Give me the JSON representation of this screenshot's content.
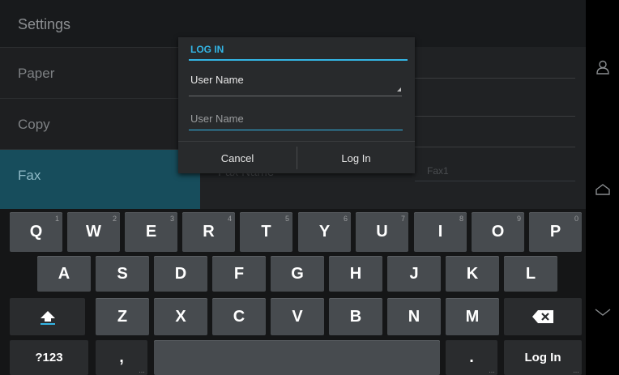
{
  "titlebar": {
    "title": "Settings"
  },
  "sidebar": {
    "items": [
      {
        "label": "Paper"
      },
      {
        "label": "Copy"
      },
      {
        "label": "Fax"
      }
    ]
  },
  "background_form": {
    "fax_name_label": "Fax Name",
    "fax_name_value": "Fax1"
  },
  "dialog": {
    "title": "LOG IN",
    "user_name_label": "User Name",
    "input_placeholder": "User Name",
    "cancel_label": "Cancel",
    "login_label": "Log In"
  },
  "navbar": {
    "icons": [
      "person-icon",
      "home-icon",
      "back-chevron-icon"
    ]
  },
  "keyboard": {
    "row1": [
      {
        "label": "Q",
        "hint": "1"
      },
      {
        "label": "W",
        "hint": "2"
      },
      {
        "label": "E",
        "hint": "3"
      },
      {
        "label": "R",
        "hint": "4"
      },
      {
        "label": "T",
        "hint": "5"
      },
      {
        "label": "Y",
        "hint": "6"
      },
      {
        "label": "U",
        "hint": "7"
      },
      {
        "label": "I",
        "hint": "8"
      },
      {
        "label": "O",
        "hint": "9"
      },
      {
        "label": "P",
        "hint": "0"
      }
    ],
    "row2": [
      "A",
      "S",
      "D",
      "F",
      "G",
      "H",
      "J",
      "K",
      "L"
    ],
    "row3": [
      "Z",
      "X",
      "C",
      "V",
      "B",
      "N",
      "M"
    ],
    "symbols_label": "?123",
    "comma_label": ",",
    "period_label": ".",
    "enter_label": "Log In",
    "more_dots": "…"
  },
  "colors": {
    "accent": "#33b5e5",
    "sidebar_active": "#174d5c",
    "key": "#474b4f"
  }
}
